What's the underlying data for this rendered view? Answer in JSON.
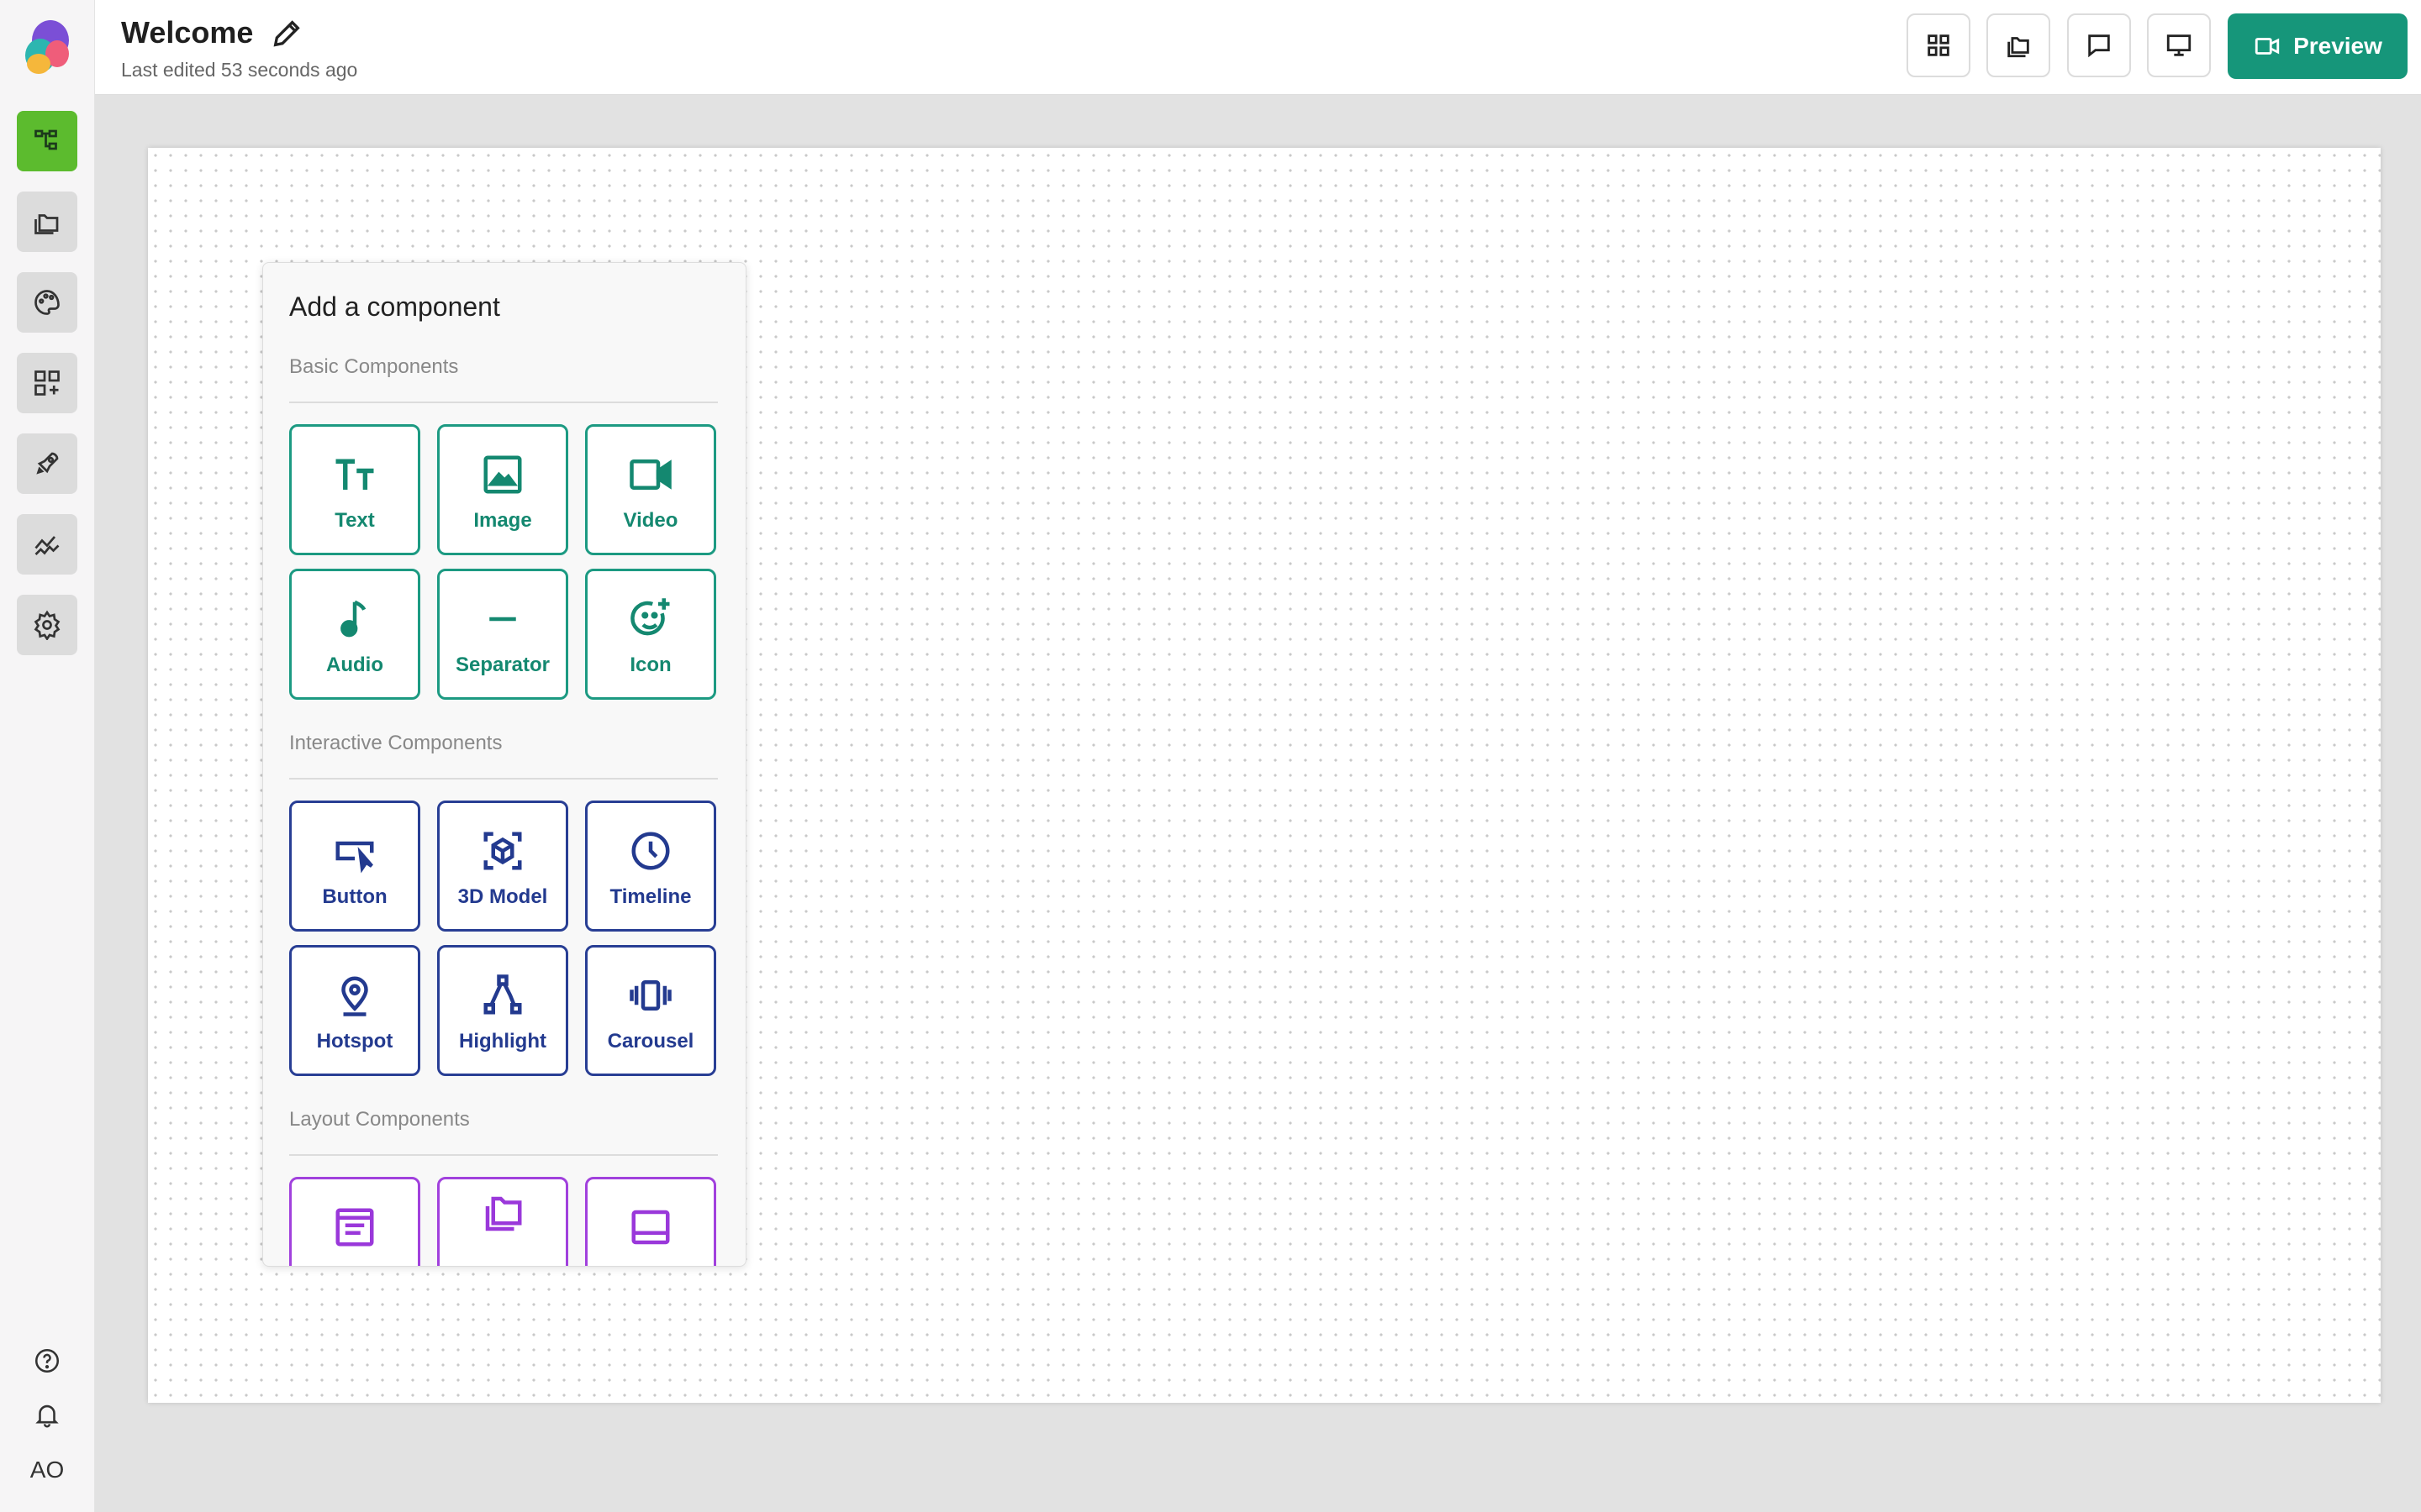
{
  "document": {
    "title": "Welcome",
    "last_edited": "Last edited 53 seconds ago"
  },
  "toolbar": {
    "preview_label": "Preview"
  },
  "sidebar": {
    "avatar_initials": "AO",
    "items": [
      "layers-icon",
      "folders-icon",
      "palette-icon",
      "add-widgets-icon",
      "rocket-icon",
      "analytics-icon",
      "settings-icon"
    ],
    "bottom": [
      "help-icon",
      "bell-icon"
    ]
  },
  "panel": {
    "title": "Add a component",
    "sections": [
      {
        "label": "Basic Components",
        "items": [
          {
            "label": "Text",
            "icon": "text-icon"
          },
          {
            "label": "Image",
            "icon": "image-icon"
          },
          {
            "label": "Video",
            "icon": "video-icon"
          },
          {
            "label": "Audio",
            "icon": "music-note-icon"
          },
          {
            "label": "Separator",
            "icon": "separator-icon"
          },
          {
            "label": "Icon",
            "icon": "emoji-add-icon"
          }
        ]
      },
      {
        "label": "Interactive Components",
        "items": [
          {
            "label": "Button",
            "icon": "button-click-icon"
          },
          {
            "label": "3D Model",
            "icon": "cube-icon"
          },
          {
            "label": "Timeline",
            "icon": "clock-icon"
          },
          {
            "label": "Hotspot",
            "icon": "map-pin-icon"
          },
          {
            "label": "Highlight",
            "icon": "nodes-icon"
          },
          {
            "label": "Carousel",
            "icon": "carousel-icon"
          }
        ]
      },
      {
        "label": "Layout Components",
        "items": [
          {
            "label": "",
            "icon": "window-text-icon"
          },
          {
            "label": "",
            "icon": "folder-stack-icon"
          },
          {
            "label": "",
            "icon": "panel-bottom-icon"
          }
        ]
      }
    ]
  },
  "colors": {
    "brand_green": "#16967a",
    "active_nav": "#5cbb2e",
    "basic_tile": "#1c9a82",
    "interactive_tile": "#283e94",
    "layout_tile": "#a141dd",
    "add_dot": "#1433e8"
  }
}
